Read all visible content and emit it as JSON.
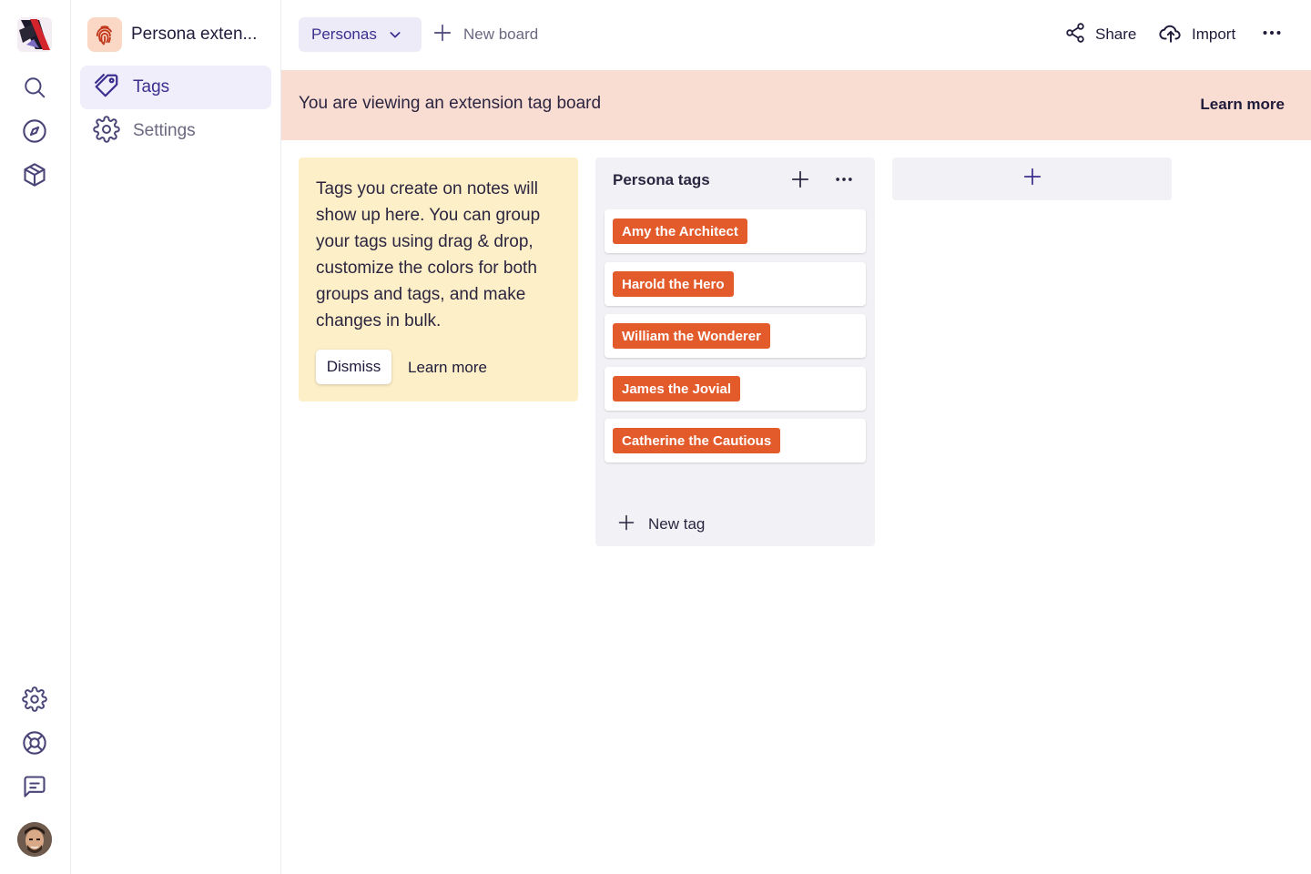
{
  "colors": {
    "accent": "#3b2f8f",
    "banner_bg": "#f9ddd3",
    "info_bg": "#fdefc8",
    "tag_color": "#e35a2b",
    "column_bg": "#f2f2f6"
  },
  "rail": {
    "logo_icon": "app-logo",
    "top_icons": [
      "search-icon",
      "compass-icon",
      "cube-icon"
    ],
    "bottom_icons": [
      "gear-icon",
      "lifebuoy-icon",
      "chat-icon"
    ],
    "avatar": "user-avatar"
  },
  "sidebar": {
    "extension_name": "Persona exten...",
    "items": [
      {
        "label": "Tags",
        "icon": "tag-icon",
        "active": true
      },
      {
        "label": "Settings",
        "icon": "gear-icon",
        "active": false
      }
    ]
  },
  "topbar": {
    "board_selector": "Personas",
    "new_board": "New board",
    "share": "Share",
    "import": "Import"
  },
  "banner": {
    "text": "You are viewing an extension tag board",
    "learn_more": "Learn more"
  },
  "info_card": {
    "text": "Tags you create on notes will show up here. You can group your tags using drag & drop, customize the colors for both groups and tags, and make changes in bulk.",
    "dismiss": "Dismiss",
    "learn_more": "Learn more"
  },
  "column": {
    "title": "Persona tags",
    "tags": [
      "Amy the Architect",
      "Harold the Hero",
      "William the Wonderer",
      "James the Jovial",
      "Catherine the Cautious"
    ],
    "new_tag": "New tag"
  }
}
